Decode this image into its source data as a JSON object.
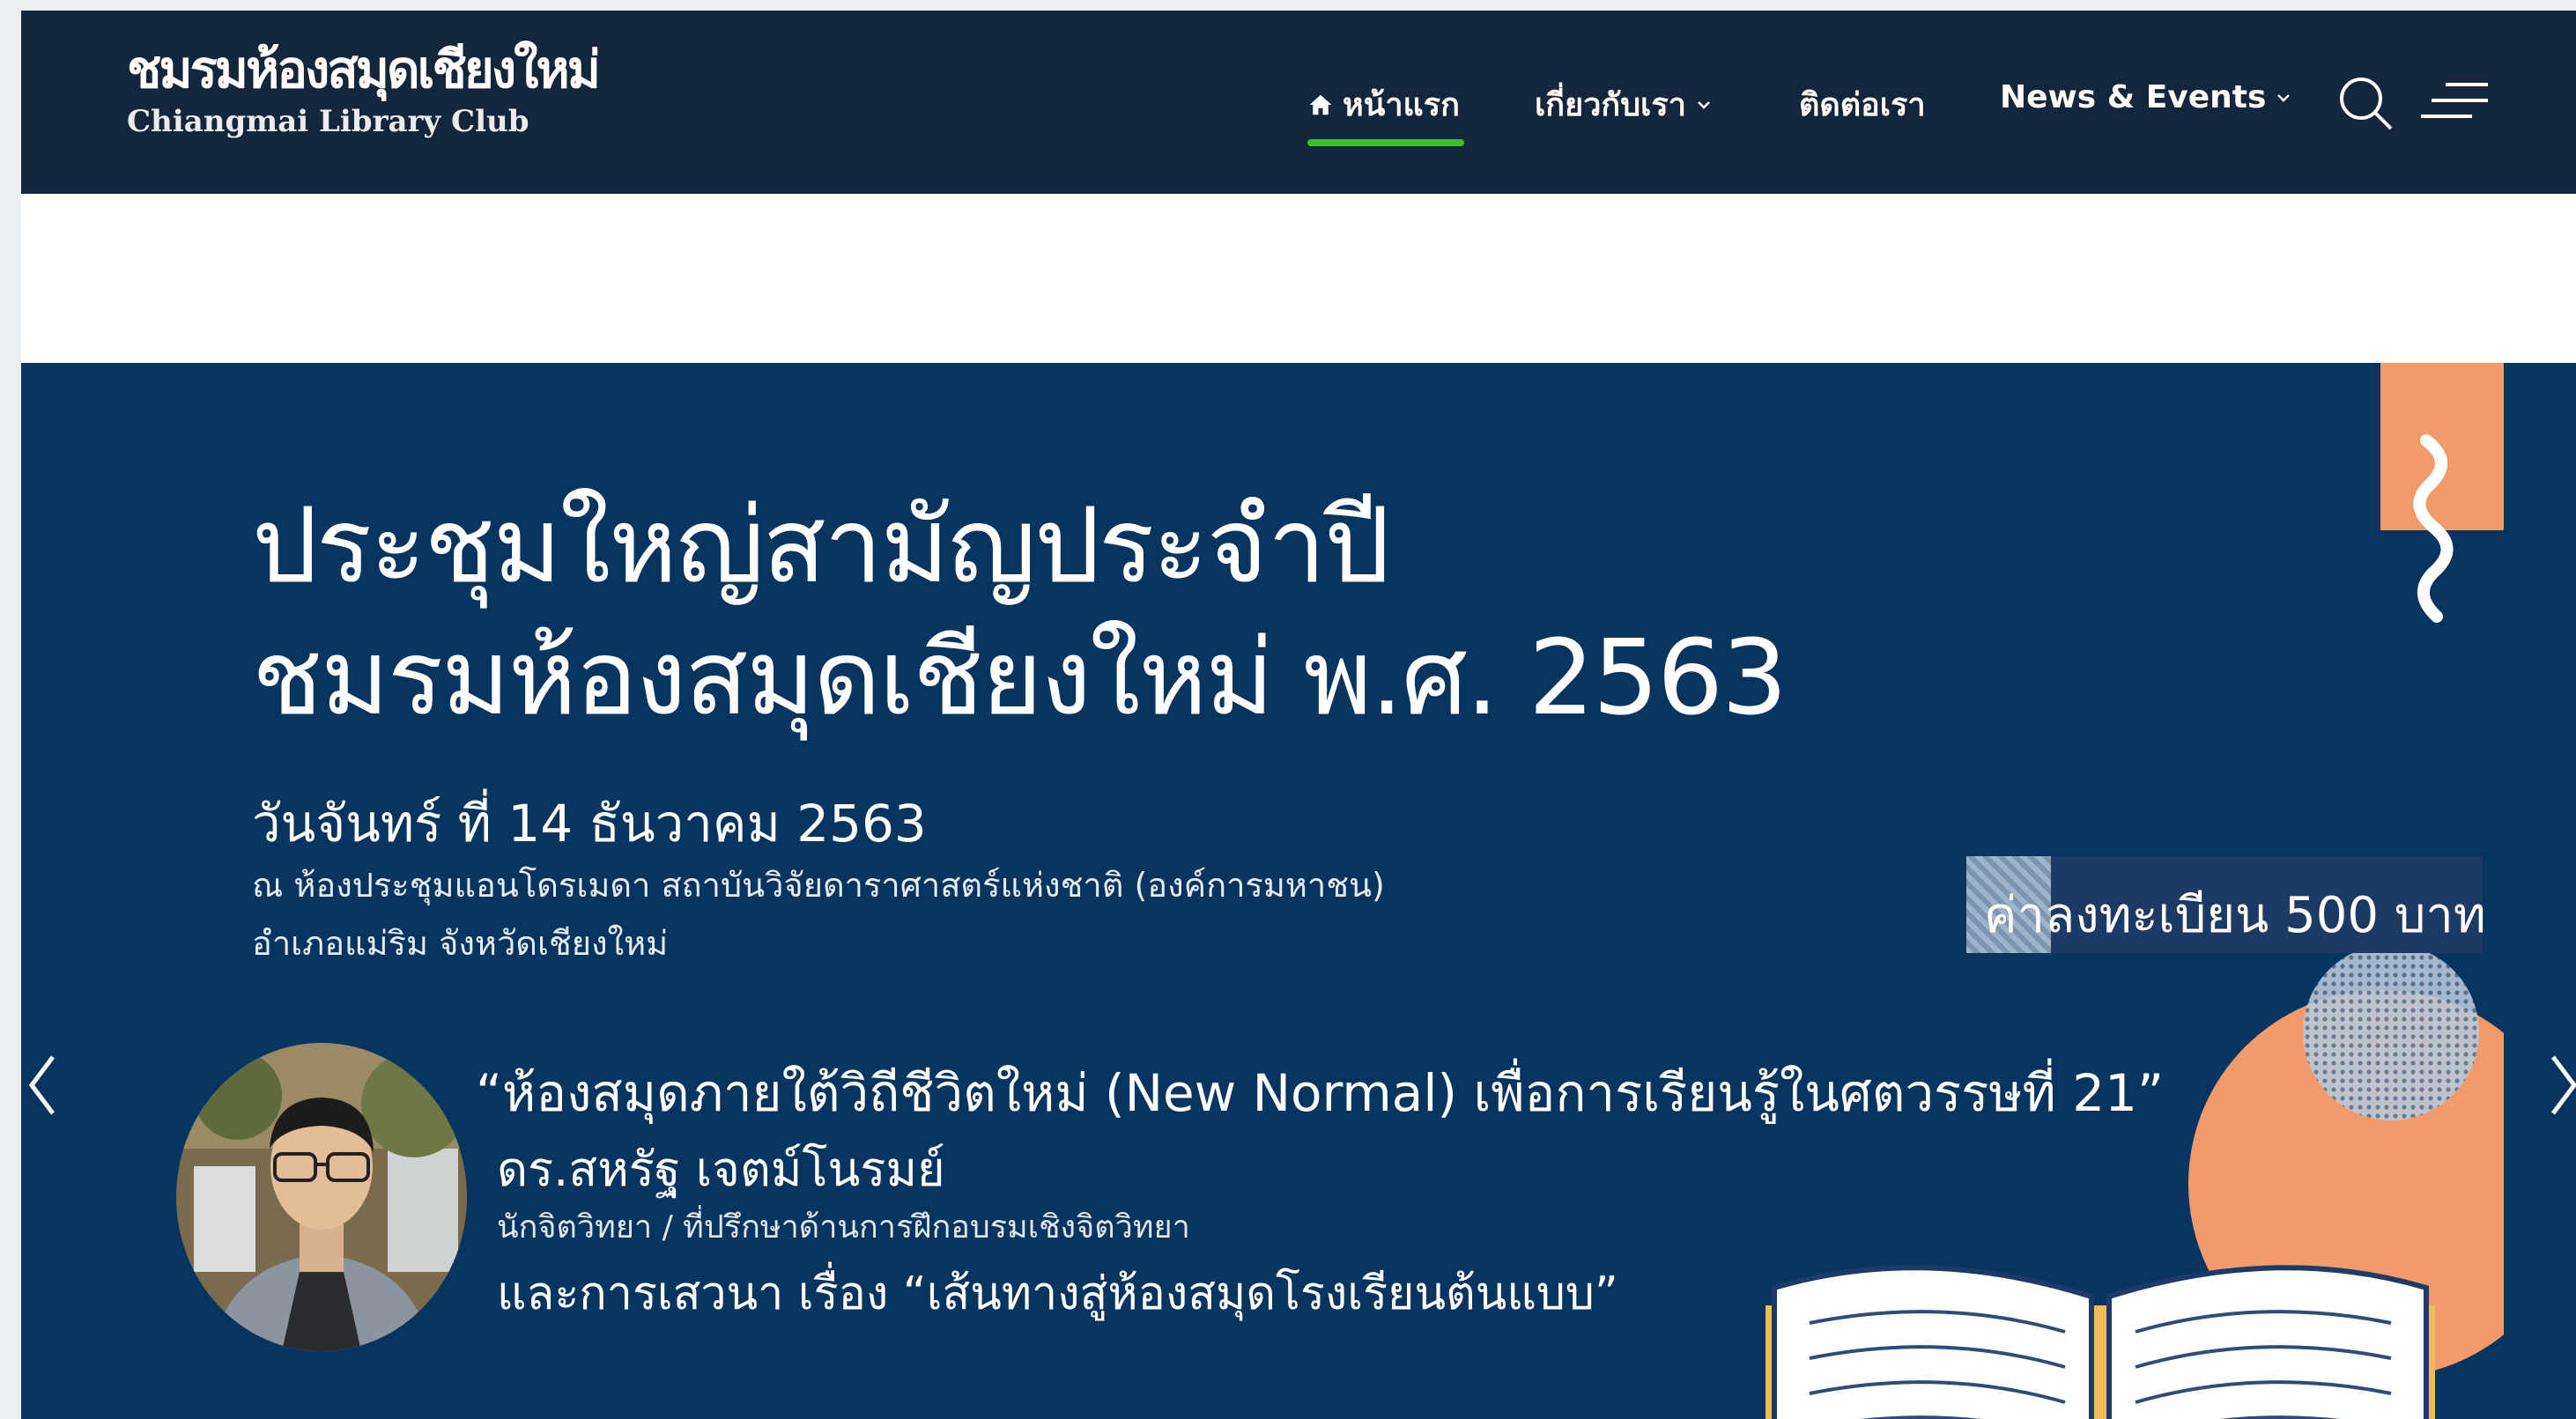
{
  "logo": {
    "thai": "ชมรมห้องสมุดเชียงใหม่",
    "english": "Chiangmai Library Club"
  },
  "nav": {
    "items": [
      {
        "label": "หน้าแรก",
        "active": true
      },
      {
        "label": "เกี่ยวกับเรา",
        "has_dropdown": true
      },
      {
        "label": "ติดต่อเรา"
      },
      {
        "label": "News & Events",
        "has_dropdown": true
      }
    ],
    "home_icon": "home-icon",
    "search_icon": "search-icon",
    "menu_icon": "menu-icon"
  },
  "banner": {
    "title_line1": "ประชุมใหญ่สามัญประจำปี",
    "title_line2": "ชมรมห้องสมุดเชียงใหม่ พ.ศ. 2563",
    "date": "วันจันทร์ ที่ 14 ธันวาคม 2563",
    "venue_line1": "ณ ห้องประชุมแอนโดรเมดา สถาบันวิจัยดาราศาสตร์แห่งชาติ (องค์การมหาชน)",
    "venue_line2": "อำเภอแม่ริม จังหวัดเชียงใหม่",
    "fee": "ค่าลงทะเบียน 500 บาท",
    "talk_title": "“ห้องสมุดภายใต้วิถีชีวิตใหม่ (New Normal) เพื่อการเรียนรู้ในศตวรรษที่ 21”",
    "speaker_name": "ดร.สหรัฐ เจตม์โนรมย์",
    "speaker_role": "นักจิตวิทยา / ที่ปรึกษาด้านการฝึกอบรมเชิงจิตวิทยา",
    "panel": "และการเสวนา เรื่อง “เส้นทางสู่ห้องสมุดโรงเรียนต้นแบบ”"
  },
  "colors": {
    "header_bg": "#14263b",
    "banner_bg": "#083560",
    "accent_green": "#43c01d",
    "accent_orange": "#f39a6c"
  }
}
